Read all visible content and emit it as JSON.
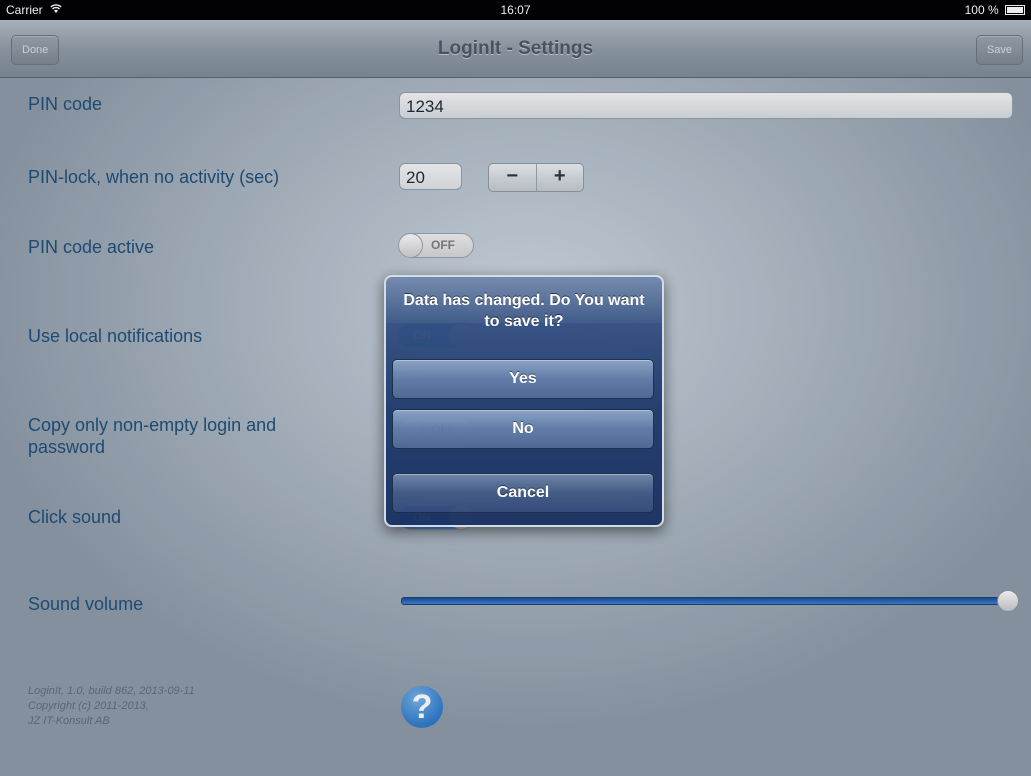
{
  "status_bar": {
    "carrier": "Carrier",
    "time": "16:07",
    "battery": "100 %"
  },
  "nav_bar": {
    "left_button": "Done",
    "title": "LoginIt - Settings",
    "right_button": "Save"
  },
  "settings": {
    "pin_code": {
      "label": "PIN code",
      "value": "1234"
    },
    "pin_lock": {
      "label": "PIN-lock, when no activity (sec)",
      "value": "20",
      "minus": "−",
      "plus": "+"
    },
    "pin_active": {
      "label": "PIN code active",
      "state": "OFF"
    },
    "local_notifications": {
      "label": "Use local notifications",
      "state": "ON"
    },
    "copy_nonempty": {
      "label": "Copy only non-empty login and password",
      "state": "OFF"
    },
    "click_sound": {
      "label": "Click sound",
      "state": "ON"
    },
    "sound_volume": {
      "label": "Sound volume",
      "level": 1.0
    }
  },
  "footer": {
    "line1": "LoginIt, 1.0, build 862, 2013-09-11",
    "line2": "Copyright (c) 2011-2013,",
    "line3": "JZ IT-Konsult AB",
    "help_icon": "question-mark-icon",
    "help_glyph": "?"
  },
  "alert": {
    "message": "Data has changed. Do You want to save it?",
    "yes": "Yes",
    "no": "No",
    "cancel": "Cancel"
  },
  "colors": {
    "label": "#1f4f78",
    "toggle_on": "#2a6fc0",
    "alert_bg": "#1f3a6b"
  }
}
